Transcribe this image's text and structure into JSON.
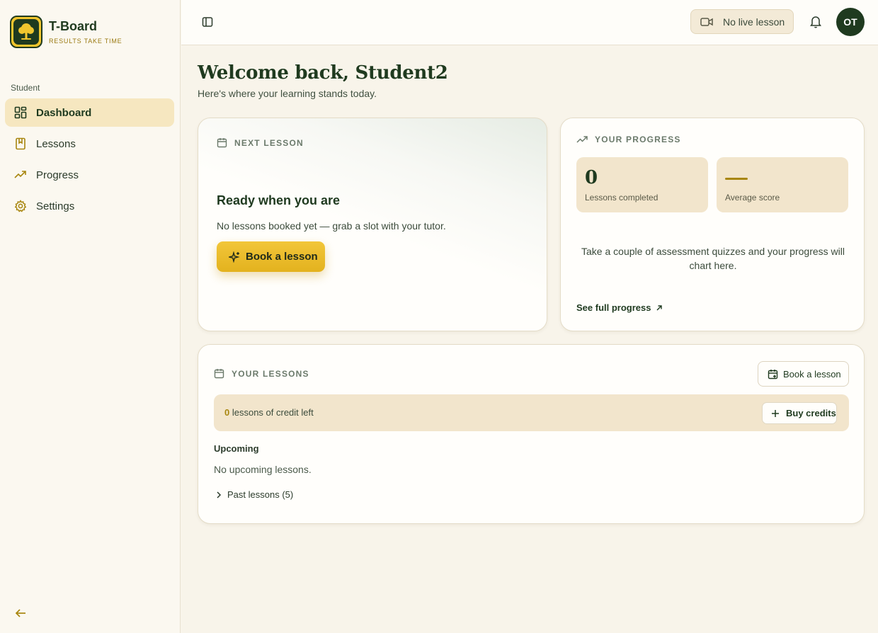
{
  "brand": {
    "name": "T-Board",
    "tagline": "RESULTS TAKE TIME"
  },
  "sidebar": {
    "section": "Student",
    "items": [
      {
        "label": "Dashboard",
        "icon": "dashboard-icon",
        "active": true
      },
      {
        "label": "Lessons",
        "icon": "book-icon"
      },
      {
        "label": "Progress",
        "icon": "trending-up-icon"
      },
      {
        "label": "Settings",
        "icon": "gear-icon"
      }
    ]
  },
  "topbar": {
    "live_label": "No live lesson",
    "avatar_initials": "OT"
  },
  "main": {
    "welcome": "Welcome back, Student2",
    "subtitle": "Here's where your learning stands today."
  },
  "next_lesson": {
    "heading": "NEXT LESSON",
    "title": "Ready when you are",
    "text": "No lessons booked yet — grab a slot with your tutor.",
    "button": "Book a lesson"
  },
  "progress": {
    "heading": "YOUR PROGRESS",
    "lessons_completed_value": "0",
    "lessons_completed_label": "Lessons completed",
    "average_score_label": "Average score",
    "message": "Take a couple of assessment quizzes and your progress will chart here.",
    "link": "See full progress"
  },
  "lessons": {
    "heading": "YOUR LESSONS",
    "book_button": "Book a lesson",
    "credits_count": "0",
    "credits_text": " lessons of credit left",
    "buy_button": "Buy credits",
    "upcoming_label": "Upcoming",
    "upcoming_empty": "No upcoming lessons.",
    "past_label": "Past lessons (5)"
  },
  "colors": {
    "primary": "#1f3a1f",
    "accent": "#f0c52e",
    "gold_text": "#a8860f",
    "background": "#f8f4ea"
  }
}
